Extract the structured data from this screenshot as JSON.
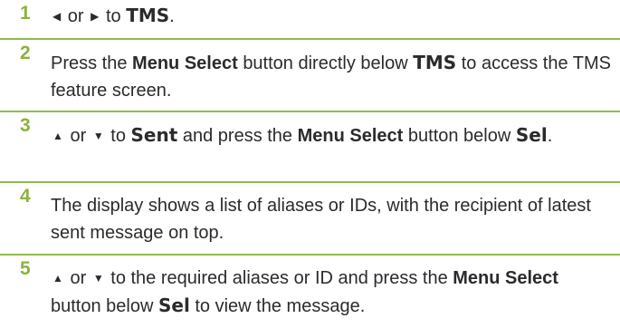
{
  "steps": [
    {
      "number": "1",
      "left_arrow": "◀",
      "or": "or",
      "right_arrow": "▶",
      "to": "to",
      "target": "TMS",
      "end": "."
    },
    {
      "number": "2",
      "pre": "Press the",
      "button": "Menu Select",
      "mid": "button directly below",
      "target": "TMS",
      "post": "to access the TMS feature screen."
    },
    {
      "number": "3",
      "up_arrow": "▲",
      "or": "or",
      "down_arrow": "▼",
      "to": "to",
      "target": "Sent",
      "mid": "and press the",
      "button": "Menu Select",
      "mid2": "button below",
      "target2": "Sel",
      "end": "."
    },
    {
      "number": "4",
      "text": "The display shows a list of aliases or IDs, with the recipient of latest sent message on top."
    },
    {
      "number": "5",
      "up_arrow": "▲",
      "or": "or",
      "down_arrow": "▼",
      "mid": "to the required aliases or ID and press the",
      "button": "Menu Select",
      "mid2": "button below",
      "target": "Sel",
      "post": "to view the message."
    }
  ]
}
